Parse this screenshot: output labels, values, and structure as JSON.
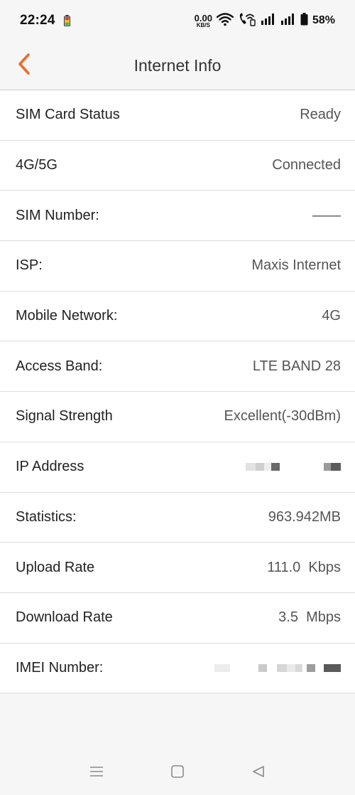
{
  "status_bar": {
    "time": "22:24",
    "net_speed_value": "0.00",
    "net_speed_unit": "KB/S",
    "battery_percent": "58%"
  },
  "header": {
    "title": "Internet Info"
  },
  "rows": [
    {
      "label": "SIM Card Status",
      "value": "Ready"
    },
    {
      "label": "4G/5G",
      "value": "Connected"
    },
    {
      "label": "SIM Number:",
      "value": "——"
    },
    {
      "label": "ISP:",
      "value": "Maxis Internet"
    },
    {
      "label": "Mobile Network:",
      "value": "4G"
    },
    {
      "label": "Access Band:",
      "value": "LTE BAND 28"
    },
    {
      "label": "Signal Strength",
      "value": "Excellent(-30dBm)"
    },
    {
      "label": "IP Address",
      "value": ""
    },
    {
      "label": "Statistics:",
      "value": "963.942MB"
    },
    {
      "label": "Upload Rate",
      "value": "111.0  Kbps"
    },
    {
      "label": "Download Rate",
      "value": "3.5  Mbps"
    },
    {
      "label": "IMEI Number:",
      "value": ""
    }
  ],
  "colors": {
    "accent": "#ee6a2a",
    "background": "#f6f6f6",
    "list_background": "#ffffff",
    "divider": "#dcdcdc"
  },
  "icons": {
    "back": "chevron-left-icon",
    "wifi": "wifi-icon",
    "wifi_call": "wifi-calling-icon",
    "signal": "signal-icon",
    "battery": "battery-icon",
    "nav_menu": "menu-icon",
    "nav_home": "home-icon",
    "nav_back": "back-triangle-icon"
  }
}
